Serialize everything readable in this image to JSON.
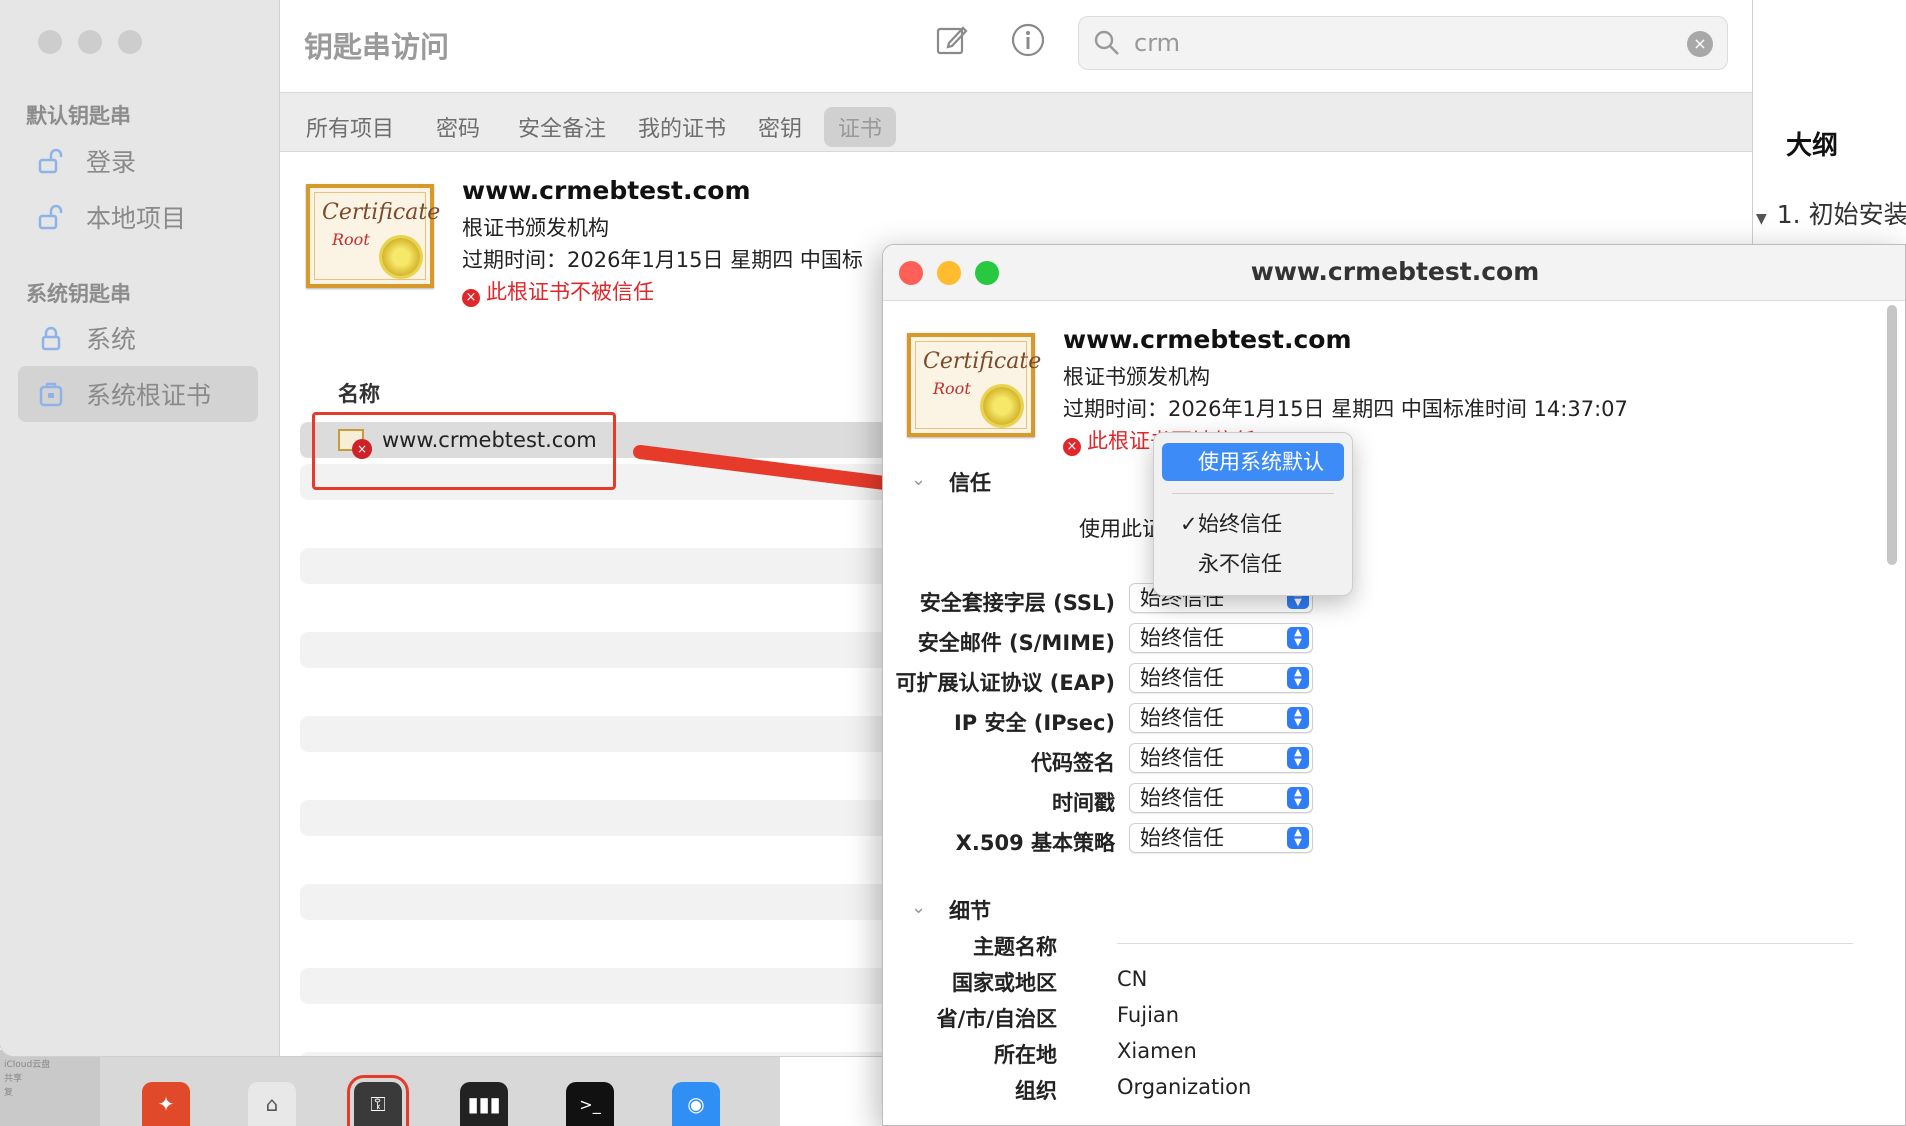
{
  "background_doc": {
    "outline_title": "大纲",
    "outline_item": "1. 初始安装"
  },
  "main_window": {
    "title": "钥匙串访问",
    "search": {
      "value": "crm"
    },
    "sidebar": {
      "default_section": "默认钥匙串",
      "system_section": "系统钥匙串",
      "items": [
        {
          "label": "登录",
          "icon": "unlock-icon"
        },
        {
          "label": "本地项目",
          "icon": "unlock-icon"
        },
        {
          "label": "系统",
          "icon": "lock-icon"
        },
        {
          "label": "系统根证书",
          "icon": "cabinet-icon",
          "selected": true
        }
      ]
    },
    "tabs": [
      "所有项目",
      "密码",
      "安全备注",
      "我的证书",
      "密钥",
      "证书"
    ],
    "selected_tab": "证书",
    "cert": {
      "name": "www.crmebtest.com",
      "type": "根证书颁发机构",
      "expiry": "过期时间：2026年1月15日 星期四 中国标",
      "warning": "此根证书不被信任",
      "img_word1": "Certificate",
      "img_word2": "Root"
    },
    "column_header": "名称",
    "selected_row": "www.crmebtest.com"
  },
  "dialog": {
    "title": "www.crmebtest.com",
    "cert": {
      "name": "www.crmebtest.com",
      "type": "根证书颁发机构",
      "expiry": "过期时间：2026年1月15日 星期四 中国标准时间 14:37:07",
      "warning": "此根证书不被信任"
    },
    "trust": {
      "section_label": "信任",
      "when_using_label": "使用此证书时",
      "rows": [
        {
          "label": "安全套接字层 (SSL)",
          "value": "始终信任"
        },
        {
          "label": "安全邮件 (S/MIME)",
          "value": "始终信任"
        },
        {
          "label": "可扩展认证协议 (EAP)",
          "value": "始终信任"
        },
        {
          "label": "IP 安全 (IPsec)",
          "value": "始终信任"
        },
        {
          "label": "代码签名",
          "value": "始终信任"
        },
        {
          "label": "时间戳",
          "value": "始终信任"
        },
        {
          "label": "X.509 基本策略",
          "value": "始终信任"
        }
      ],
      "help": "?"
    },
    "details": {
      "section_label": "细节",
      "subject_label": "主题名称",
      "rows": [
        {
          "label": "国家或地区",
          "value": "CN"
        },
        {
          "label": "省/市/自治区",
          "value": "Fujian"
        },
        {
          "label": "所在地",
          "value": "Xiamen"
        },
        {
          "label": "组织",
          "value": "Organization"
        }
      ]
    },
    "dropdown_menu": {
      "items": [
        {
          "label": "使用系统默认",
          "highlighted": true
        },
        {
          "label": "始终信任",
          "checked": true
        },
        {
          "label": "永不信任"
        }
      ],
      "checkmark": "✓"
    }
  },
  "dock": {
    "left_labels": [
      "iCloud云盘",
      "共享",
      "复"
    ]
  },
  "colors": {
    "accent": "#3d8bf7",
    "warning": "#e0272b",
    "annotation": "#e63a2b"
  }
}
